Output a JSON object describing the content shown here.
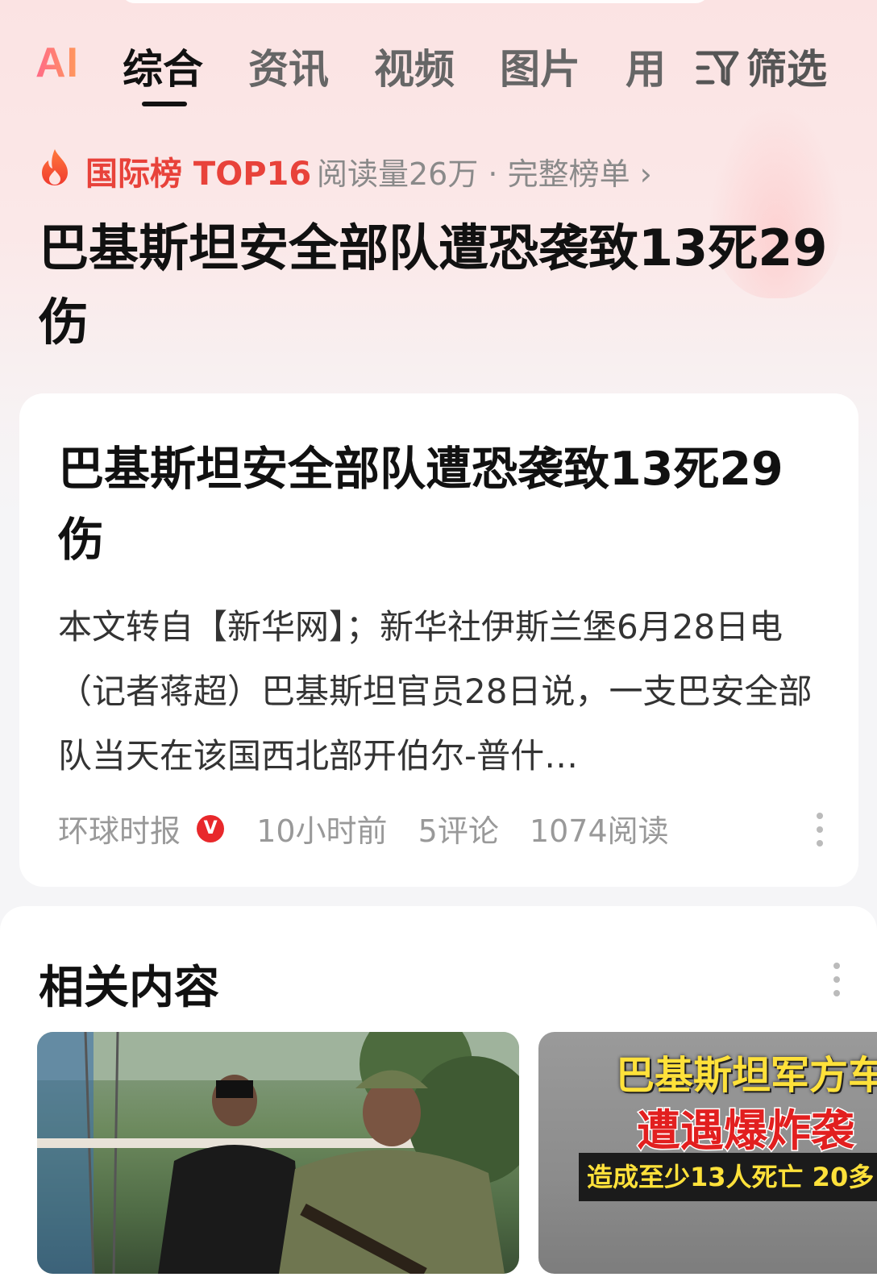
{
  "tabs": {
    "ai_logo": "AI",
    "items": [
      "综合",
      "资讯",
      "视频",
      "图片",
      "用"
    ],
    "active_index": 0,
    "filter_label": "筛选"
  },
  "ranking": {
    "label": "国际榜 TOP16",
    "meta": "阅读量26万 · 完整榜单 ›"
  },
  "headline": "巴基斯坦安全部队遭恐袭致13死29伤",
  "card": {
    "title": "巴基斯坦安全部队遭恐袭致13死29伤",
    "summary": "本文转自【新华网】；新华社伊斯兰堡6月28日电（记者蒋超）巴基斯坦官员28日说，一支巴安全部队当天在该国西北部开伯尔-普什…",
    "source": "环球时报",
    "verified_badge": "V",
    "time": "10小时前",
    "comments": "5评论",
    "reads": "1074阅读"
  },
  "related": {
    "title": "相关内容",
    "thumb2": {
      "line1": "巴基斯坦军方车",
      "line2": "遭遇爆炸袭",
      "line3": "造成至少13人死亡 20多"
    }
  },
  "colors": {
    "accent_red": "#e8423a",
    "badge_red": "#e8282b",
    "caption_yellow": "#ffe13a"
  }
}
